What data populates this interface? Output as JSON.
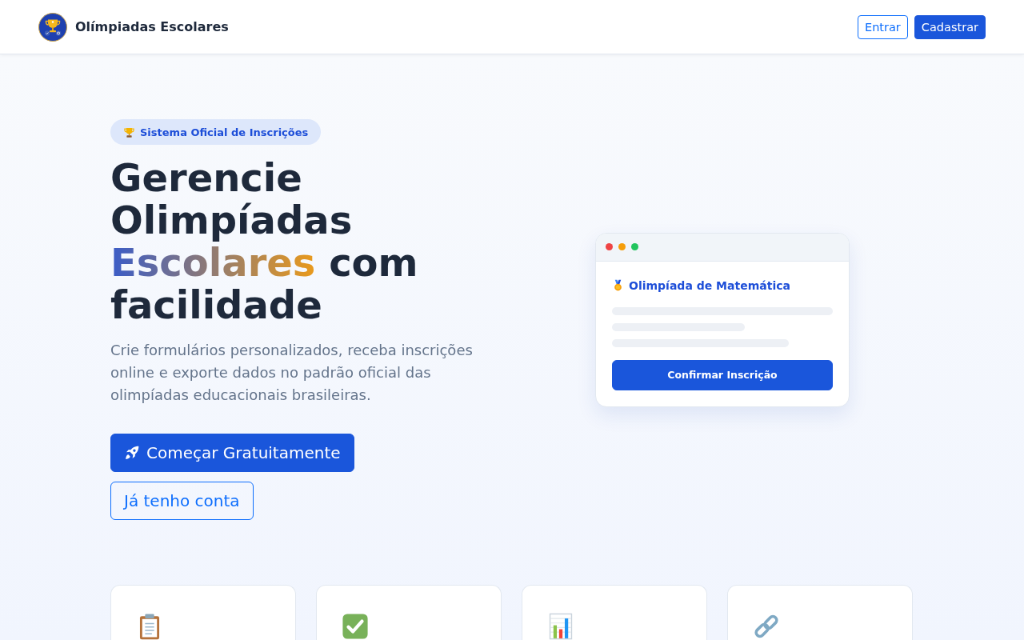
{
  "navbar": {
    "brand": "Olímpiadas Escolares",
    "buttons": [
      {
        "label": "Entrar",
        "kind": "outline"
      },
      {
        "label": "Cadastrar",
        "kind": "primary"
      }
    ]
  },
  "hero": {
    "badge": "Sistema Oficial de Inscrições",
    "headline": {
      "start": "Gerencie Olimpíadas",
      "highlight": "Escolares",
      "end": "com facilidade"
    },
    "description": "Crie formulários personalizados, receba inscrições online e exporte dados no padrão oficial das olimpíadas educacionais brasileiras.",
    "buttons": [
      {
        "label": "Começar Gratuitamente",
        "kind": "primary"
      },
      {
        "label": "Já tenho conta",
        "kind": "outline"
      }
    ]
  },
  "preview": {
    "title": "Olimpíada de Matemática",
    "button": "Confirmar Inscrição"
  },
  "features": [
    {
      "kind": "clipboard"
    },
    {
      "kind": "check"
    },
    {
      "kind": "chart"
    },
    {
      "kind": "link"
    }
  ]
}
